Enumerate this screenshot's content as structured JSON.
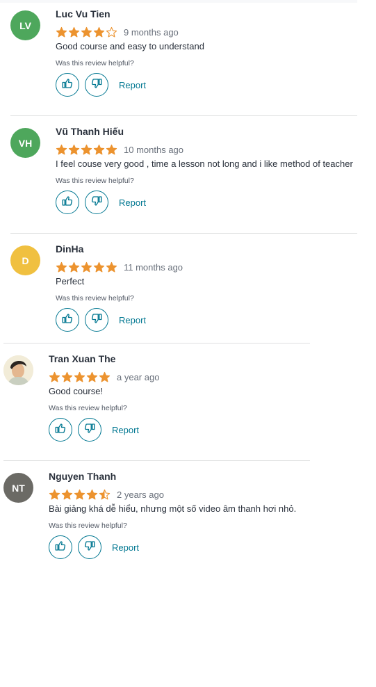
{
  "helpful_prompt": "Was this review helpful?",
  "report_label": "Report",
  "colors": {
    "star": "#ec932f",
    "accent": "#007791"
  },
  "reviews": [
    {
      "initials": "LV",
      "name": "Luc Vu Tien",
      "avatar_color": "#4ea75c",
      "rating": 4,
      "date": "9 months ago",
      "text": "Good course and easy to understand"
    },
    {
      "initials": "VH",
      "name": "Vũ Thanh Hiếu",
      "avatar_color": "#4ea75c",
      "rating": 5,
      "date": "10 months ago",
      "text": "I feel couse very good , time a lesson not long and i like method of teacher"
    },
    {
      "initials": "D",
      "name": "DinHa",
      "avatar_color": "#f0c040",
      "rating": 5,
      "date": "11 months ago",
      "text": "Perfect"
    },
    {
      "initials": "",
      "name": "Tran Xuan The",
      "avatar_color": "",
      "avatar_type": "photo",
      "rating": 5,
      "date": "a year ago",
      "text": "Good course!"
    },
    {
      "initials": "NT",
      "name": "Nguyen Thanh",
      "avatar_color": "#6b6a65",
      "rating": 4.5,
      "date": "2 years ago",
      "text": "Bài giảng khá dễ hiểu, nhưng một số video âm thanh hơi nhỏ."
    }
  ]
}
